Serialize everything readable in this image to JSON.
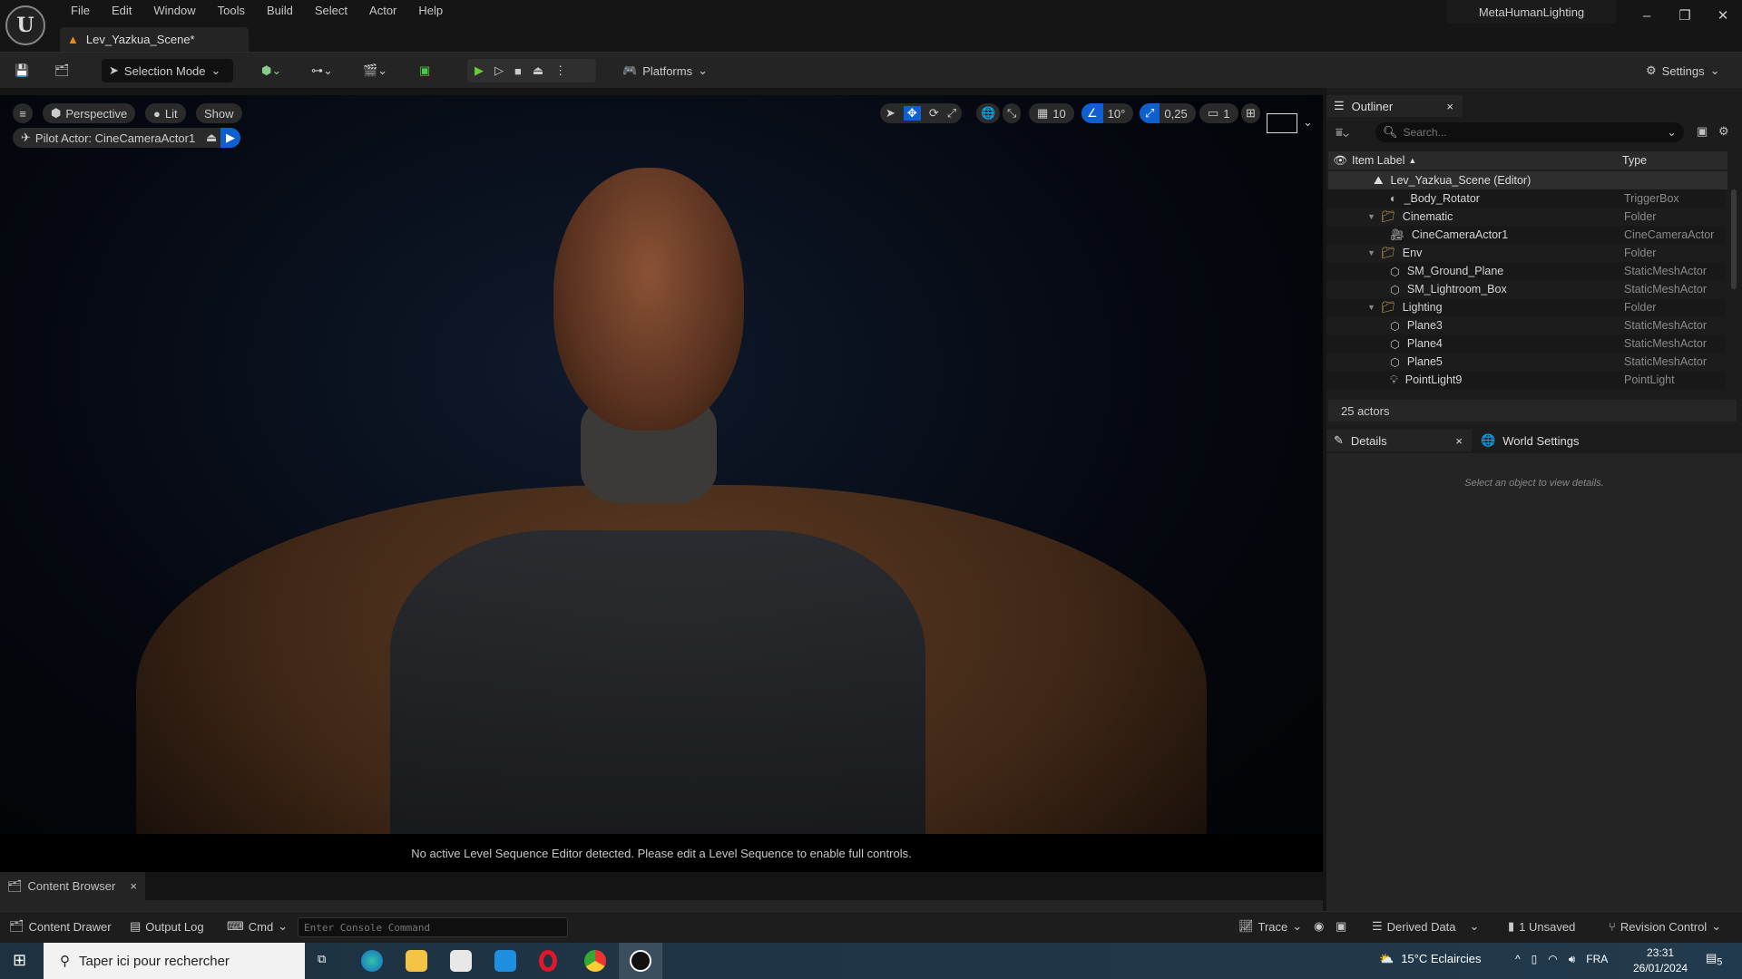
{
  "menubar": {
    "items": [
      "File",
      "Edit",
      "Window",
      "Tools",
      "Build",
      "Select",
      "Actor",
      "Help"
    ],
    "doc_tab": "Lev_Yazkua_Scene*",
    "app_title": "MetaHumanLighting"
  },
  "toolbar": {
    "selection_mode": "Selection Mode",
    "platforms": "Platforms",
    "settings": "Settings"
  },
  "viewport": {
    "perspective": "Perspective",
    "lit": "Lit",
    "show": "Show",
    "pilot": "Pilot Actor: CineCameraActor1",
    "grid_snap": "10",
    "rot_snap": "10°",
    "scale_snap": "0,25",
    "camera_speed": "1",
    "message": "No active Level Sequence Editor detected. Please edit a Level Sequence to enable full controls."
  },
  "outliner": {
    "tab": "Outliner",
    "search_placeholder": "Search...",
    "col_label": "Item Label",
    "col_type": "Type",
    "root": "Lev_Yazkua_Scene (Editor)",
    "rows": [
      {
        "label": "_Body_Rotator",
        "type": "TriggerBox"
      },
      {
        "label": "Cinematic",
        "type": "Folder"
      },
      {
        "label": "CineCameraActor1",
        "type": "CineCameraActor"
      },
      {
        "label": "Env",
        "type": "Folder"
      },
      {
        "label": "SM_Ground_Plane",
        "type": "StaticMeshActor"
      },
      {
        "label": "SM_Lightroom_Box",
        "type": "StaticMeshActor"
      },
      {
        "label": "Lighting",
        "type": "Folder"
      },
      {
        "label": "Plane3",
        "type": "StaticMeshActor"
      },
      {
        "label": "Plane4",
        "type": "StaticMeshActor"
      },
      {
        "label": "Plane5",
        "type": "StaticMeshActor"
      },
      {
        "label": "PointLight9",
        "type": "PointLight"
      }
    ],
    "count": "25 actors"
  },
  "details": {
    "tab": "Details",
    "world_tab": "World Settings",
    "empty": "Select an object to view details."
  },
  "bottom": {
    "content_browser": "Content Browser",
    "content_drawer": "Content Drawer",
    "output_log": "Output Log",
    "cmd": "Cmd",
    "console_placeholder": "Enter Console Command",
    "trace": "Trace",
    "derived": "Derived Data",
    "unsaved": "1 Unsaved",
    "revision": "Revision Control"
  },
  "taskbar": {
    "search": "Taper ici pour rechercher",
    "weather": "15°C  Eclaircies",
    "lang": "FRA",
    "time": "23:31",
    "date": "26/01/2024",
    "notifications": "5"
  }
}
